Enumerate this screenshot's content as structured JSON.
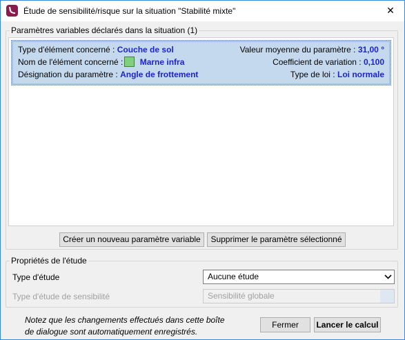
{
  "window": {
    "title": "Étude de sensibilité/risque sur la situation \"Stabilité mixte\"",
    "close_glyph": "✕"
  },
  "parameters_group": {
    "legend": "Paramètres variables déclarés dans la situation (1)",
    "items": [
      {
        "element_type_label": "Type d'élément concerné :",
        "element_type_value": "Couche de sol",
        "element_name_label": "Nom de l'élément concerné :",
        "element_name_value": "Marne infra",
        "element_color": "#7fd07f",
        "designation_label": "Désignation du paramètre :",
        "designation_value": "Angle de frottement",
        "mean_label": "Valeur moyenne du paramètre :",
        "mean_value": "31,00 °",
        "cv_label": "Coefficient de variation :",
        "cv_value": "0,100",
        "law_label": "Type de loi :",
        "law_value": "Loi normale"
      }
    ],
    "create_button": "Créer un nouveau paramètre variable",
    "delete_button": "Supprimer le paramètre sélectionné"
  },
  "study_group": {
    "legend": "Propriétés de l'étude",
    "study_type_label": "Type d'étude",
    "study_type_value": "Aucune étude",
    "sensitivity_label": "Type d'étude de sensibilité",
    "sensitivity_value": "Sensibilité globale"
  },
  "footer": {
    "note_line1": "Notez que les changements effectués dans cette boîte",
    "note_line2": "de dialogue sont automatiquement enregistrés.",
    "close_button": "Fermer",
    "run_button": "Lancer le calcul"
  },
  "colors": {
    "value_text": "#1d24c8",
    "selected_row": "#c5d9ee",
    "window_border": "#3c86d6"
  }
}
